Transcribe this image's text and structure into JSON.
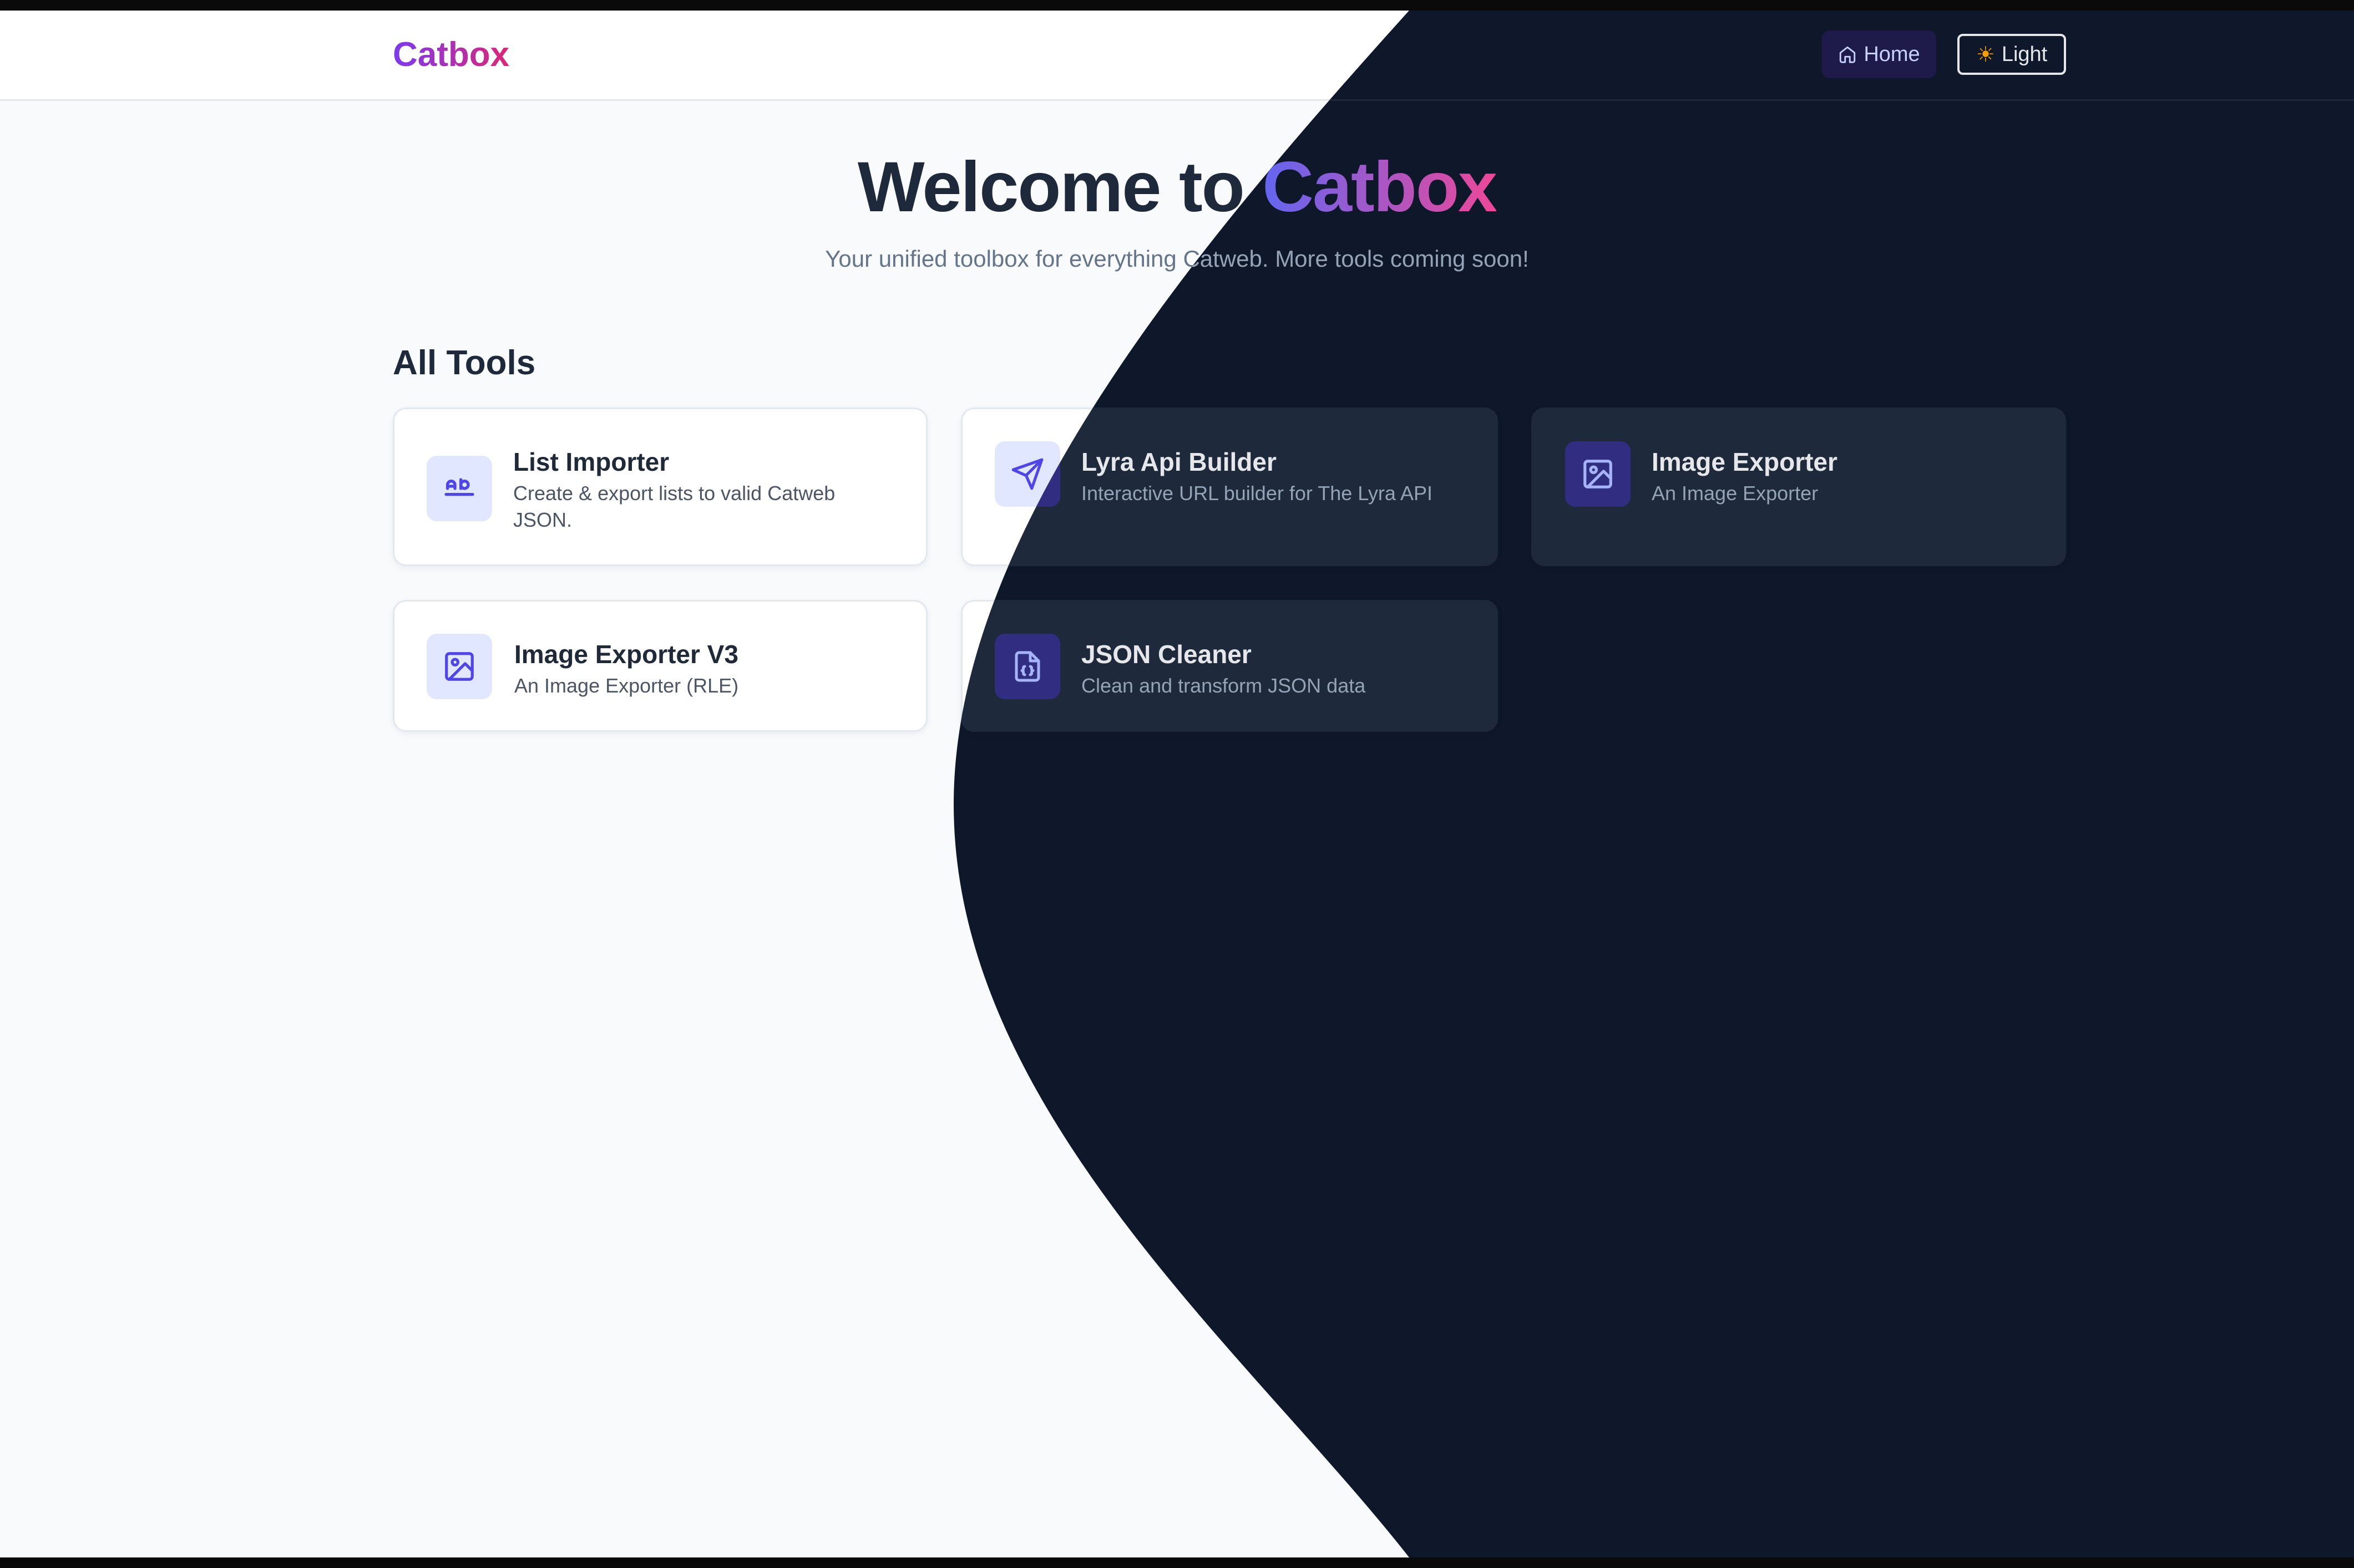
{
  "nav": {
    "brand": "Catbox",
    "home_label": "Home",
    "theme_label": "Light"
  },
  "hero": {
    "title_prefix": "Welcome to",
    "title_accent": "Catbox",
    "subtitle": "Your unified toolbox for everything Catweb. More tools coming soon!"
  },
  "section": {
    "title": "All Tools"
  },
  "tools": [
    {
      "title": "List Importer",
      "description": "Create & export lists to valid Catweb JSON.",
      "icon": "text-ab-icon"
    },
    {
      "title": "Lyra Api Builder",
      "description": "Interactive URL builder for The Lyra API",
      "icon": "send-icon"
    },
    {
      "title": "Image Exporter",
      "description": "An Image Exporter",
      "icon": "image-icon"
    },
    {
      "title": "Image Exporter V3",
      "description": "An Image Exporter (RLE)",
      "icon": "image-icon"
    },
    {
      "title": "JSON Cleaner",
      "description": "Clean and transform JSON data",
      "icon": "file-json-icon"
    }
  ],
  "colors": {
    "light_bg": "#f8fafc",
    "dark_bg": "#0f172a",
    "accent_start": "#6366f1",
    "accent_end": "#ec4899"
  }
}
